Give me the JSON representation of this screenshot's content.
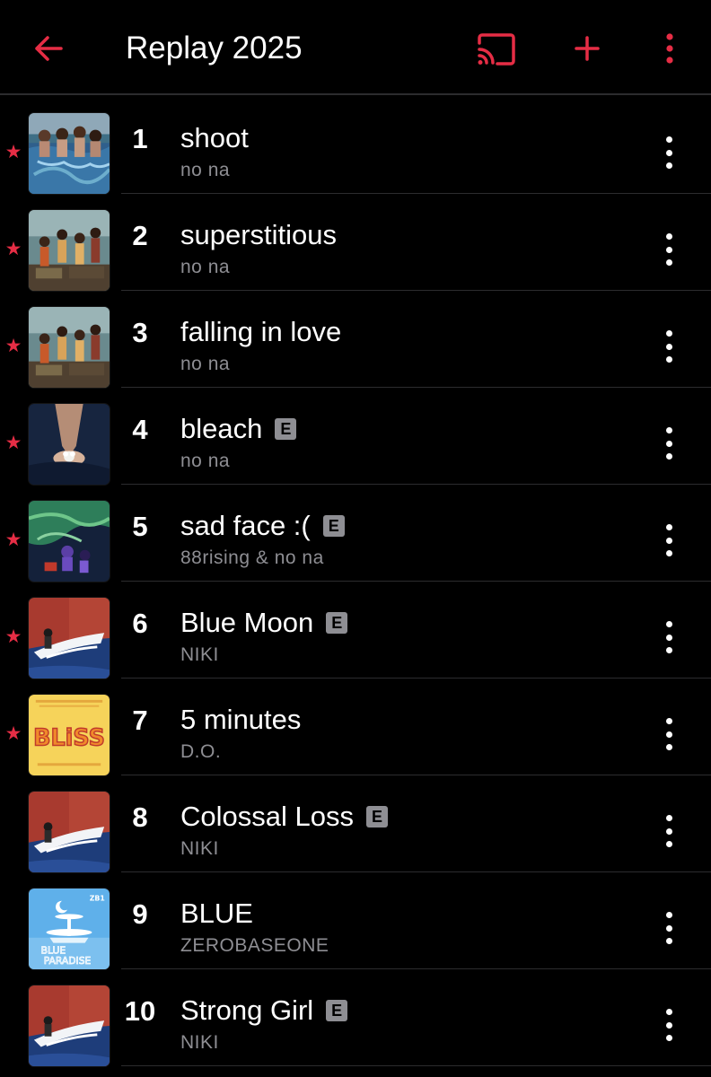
{
  "colors": {
    "accent": "#e62d45",
    "background": "#000000",
    "secondary_text": "#8e8e93",
    "divider": "#2c2c2e"
  },
  "header": {
    "title": "Replay 2025",
    "icons": [
      "back-arrow-icon",
      "cast-icon",
      "plus-icon",
      "more-vertical-icon"
    ]
  },
  "tracks": [
    {
      "rank": "1",
      "title": "shoot",
      "artist": "no na",
      "explicit": false,
      "starred": true,
      "art": "shoot"
    },
    {
      "rank": "2",
      "title": "superstitious",
      "artist": "no na",
      "explicit": false,
      "starred": true,
      "art": "superstitious"
    },
    {
      "rank": "3",
      "title": "falling in love",
      "artist": "no na",
      "explicit": false,
      "starred": true,
      "art": "superstitious"
    },
    {
      "rank": "4",
      "title": "bleach",
      "artist": "no na",
      "explicit": true,
      "starred": true,
      "art": "bleach"
    },
    {
      "rank": "5",
      "title": "sad face :(",
      "artist": "88rising & no na",
      "explicit": true,
      "starred": true,
      "art": "sadface"
    },
    {
      "rank": "6",
      "title": "Blue Moon",
      "artist": "NIKI",
      "explicit": true,
      "starred": true,
      "art": "niki"
    },
    {
      "rank": "7",
      "title": "5 minutes",
      "artist": "D.O.",
      "explicit": false,
      "starred": true,
      "art": "bliss"
    },
    {
      "rank": "8",
      "title": "Colossal Loss",
      "artist": "NIKI",
      "explicit": true,
      "starred": false,
      "art": "niki"
    },
    {
      "rank": "9",
      "title": "BLUE",
      "artist": "ZEROBASEONE",
      "explicit": false,
      "starred": false,
      "art": "blueparadise"
    },
    {
      "rank": "10",
      "title": "Strong Girl",
      "artist": "NIKI",
      "explicit": true,
      "starred": false,
      "art": "niki"
    }
  ],
  "explicit_badge": "E",
  "star_glyph": "★",
  "album_art_text": {
    "bliss": "BLiSS",
    "blueparadise": [
      "BLUE",
      "PARADISE"
    ],
    "zb1": "ZB1"
  }
}
